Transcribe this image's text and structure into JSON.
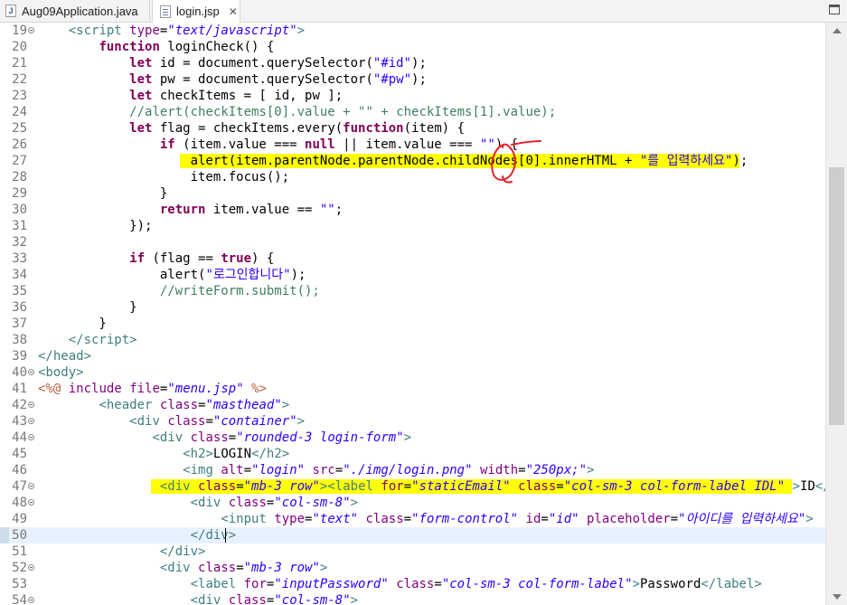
{
  "tabs": [
    {
      "label": "Aug09Application.java",
      "icon": "java-file-icon",
      "active": false
    },
    {
      "label": "login.jsp",
      "icon": "jsp-file-icon",
      "active": true,
      "close": "✕"
    }
  ],
  "editor": {
    "first_line": 19,
    "current_line": 50,
    "fold_lines": [
      19,
      40,
      42,
      43,
      44,
      47,
      48,
      52,
      54
    ],
    "gutter_marks": [
      50
    ],
    "highlight_color": "#ffff00",
    "annotation_color": "#e8202a",
    "lines": [
      [
        [
          "",
          "    "
        ],
        [
          "t",
          "<"
        ],
        [
          "t",
          "script"
        ],
        [
          "",
          " "
        ],
        [
          "an",
          "type"
        ],
        [
          "",
          "="
        ],
        [
          "av",
          "\"text/javascript\""
        ],
        [
          "t",
          ">"
        ]
      ],
      [
        [
          "",
          "        "
        ],
        [
          "k",
          "function"
        ],
        [
          "",
          " loginCheck() {"
        ]
      ],
      [
        [
          "",
          "            "
        ],
        [
          "k",
          "let"
        ],
        [
          "",
          " id = document.querySelector("
        ],
        [
          "s",
          "\"#id\""
        ],
        [
          "",
          ");"
        ]
      ],
      [
        [
          "",
          "            "
        ],
        [
          "k",
          "let"
        ],
        [
          "",
          " pw = document.querySelector("
        ],
        [
          "s",
          "\"#pw\""
        ],
        [
          "",
          ");"
        ]
      ],
      [
        [
          "",
          "            "
        ],
        [
          "k",
          "let"
        ],
        [
          "",
          " checkItems = [ id, pw ];"
        ]
      ],
      [
        [
          "",
          "            "
        ],
        [
          "c",
          "//alert(checkItems[0].value + \"\" + checkItems[1].value);"
        ]
      ],
      [
        [
          "",
          "            "
        ],
        [
          "k",
          "let"
        ],
        [
          "",
          " flag = checkItems.every("
        ],
        [
          "k",
          "function"
        ],
        [
          "",
          "(item) {"
        ]
      ],
      [
        [
          "",
          "                "
        ],
        [
          "k",
          "if"
        ],
        [
          "",
          " (item.value === "
        ],
        [
          "k",
          "null"
        ],
        [
          "",
          " || item.value === "
        ],
        [
          "s",
          "\"\""
        ],
        [
          "",
          ") {"
        ]
      ],
      [
        [
          "",
          "                    alert(item.parentNode.parentNode.childNodes[0].innerHTML + "
        ],
        [
          "s",
          "\"를 입력하세요\""
        ],
        [
          "",
          ");"
        ]
      ],
      [
        [
          "",
          "                    item.focus();"
        ]
      ],
      [
        [
          "",
          "                }"
        ]
      ],
      [
        [
          "",
          "                "
        ],
        [
          "k",
          "return"
        ],
        [
          "",
          " item.value == "
        ],
        [
          "s",
          "\"\""
        ],
        [
          "",
          ";"
        ]
      ],
      [
        [
          "",
          "            });"
        ]
      ],
      [
        [
          "",
          ""
        ]
      ],
      [
        [
          "",
          "            "
        ],
        [
          "k",
          "if"
        ],
        [
          "",
          " (flag == "
        ],
        [
          "k",
          "true"
        ],
        [
          "",
          ") {"
        ]
      ],
      [
        [
          "",
          "                alert("
        ],
        [
          "s",
          "\"로그인합니다\""
        ],
        [
          "",
          ");"
        ]
      ],
      [
        [
          "",
          "                "
        ],
        [
          "c",
          "//writeForm.submit();"
        ]
      ],
      [
        [
          "",
          "            }"
        ]
      ],
      [
        [
          "",
          "        }"
        ]
      ],
      [
        [
          "",
          "    "
        ],
        [
          "t",
          "</"
        ],
        [
          "t",
          "script"
        ],
        [
          "t",
          ">"
        ]
      ],
      [
        [
          "t",
          "</"
        ],
        [
          "t",
          "head"
        ],
        [
          "t",
          ">"
        ]
      ],
      [
        [
          "t",
          "<"
        ],
        [
          "t",
          "body"
        ],
        [
          "t",
          ">"
        ]
      ],
      [
        [
          "d",
          "<%@"
        ],
        [
          "",
          " "
        ],
        [
          "an",
          "include"
        ],
        [
          "",
          " "
        ],
        [
          "an",
          "file"
        ],
        [
          "",
          "="
        ],
        [
          "av",
          "\"menu.jsp\""
        ],
        [
          "",
          " "
        ],
        [
          "d",
          "%>"
        ]
      ],
      [
        [
          "",
          "        "
        ],
        [
          "t",
          "<"
        ],
        [
          "t",
          "header"
        ],
        [
          "",
          " "
        ],
        [
          "an",
          "class"
        ],
        [
          "",
          "="
        ],
        [
          "av",
          "\"masthead\""
        ],
        [
          "t",
          ">"
        ]
      ],
      [
        [
          "",
          "            "
        ],
        [
          "t",
          "<"
        ],
        [
          "t",
          "div"
        ],
        [
          "",
          " "
        ],
        [
          "an",
          "class"
        ],
        [
          "",
          "="
        ],
        [
          "av",
          "\"container\""
        ],
        [
          "t",
          ">"
        ]
      ],
      [
        [
          "",
          "               "
        ],
        [
          "t",
          "<"
        ],
        [
          "t",
          "div"
        ],
        [
          "",
          " "
        ],
        [
          "an",
          "class"
        ],
        [
          "",
          "="
        ],
        [
          "av",
          "\"rounded-3 login-form\""
        ],
        [
          "t",
          ">"
        ]
      ],
      [
        [
          "",
          "                   "
        ],
        [
          "t",
          "<"
        ],
        [
          "t",
          "h2"
        ],
        [
          "t",
          ">"
        ],
        [
          "",
          "LOGIN"
        ],
        [
          "t",
          "</"
        ],
        [
          "t",
          "h2"
        ],
        [
          "t",
          ">"
        ]
      ],
      [
        [
          "",
          "                   "
        ],
        [
          "t",
          "<"
        ],
        [
          "t",
          "img"
        ],
        [
          "",
          " "
        ],
        [
          "an",
          "alt"
        ],
        [
          "",
          "="
        ],
        [
          "av",
          "\"login\""
        ],
        [
          "",
          " "
        ],
        [
          "an",
          "src"
        ],
        [
          "",
          "="
        ],
        [
          "av",
          "\"./img/login.png\""
        ],
        [
          "",
          " "
        ],
        [
          "an",
          "width"
        ],
        [
          "",
          "="
        ],
        [
          "av",
          "\"250px;\""
        ],
        [
          "t",
          ">"
        ]
      ],
      [
        [
          "",
          "                "
        ],
        [
          "t",
          "<"
        ],
        [
          "t",
          "div"
        ],
        [
          "",
          " "
        ],
        [
          "an",
          "class"
        ],
        [
          "",
          "="
        ],
        [
          "av",
          "\"mb-3 row\""
        ],
        [
          "t",
          ">"
        ],
        [
          "t",
          "<"
        ],
        [
          "t",
          "label"
        ],
        [
          "",
          " "
        ],
        [
          "an",
          "for"
        ],
        [
          "",
          "="
        ],
        [
          "av",
          "\"staticEmail\""
        ],
        [
          "",
          " "
        ],
        [
          "an",
          "class"
        ],
        [
          "",
          "="
        ],
        [
          "av",
          "\"col-sm-3 col-form-label IDL\""
        ],
        [
          "",
          " "
        ],
        [
          "t",
          ">"
        ],
        [
          "",
          "ID"
        ],
        [
          "t",
          "</"
        ],
        [
          "t",
          "label"
        ]
      ],
      [
        [
          "",
          "                    "
        ],
        [
          "t",
          "<"
        ],
        [
          "t",
          "div"
        ],
        [
          "",
          " "
        ],
        [
          "an",
          "class"
        ],
        [
          "",
          "="
        ],
        [
          "av",
          "\"col-sm-8\""
        ],
        [
          "t",
          ">"
        ]
      ],
      [
        [
          "",
          "                        "
        ],
        [
          "t",
          "<"
        ],
        [
          "t",
          "input"
        ],
        [
          "",
          " "
        ],
        [
          "an",
          "type"
        ],
        [
          "",
          "="
        ],
        [
          "av",
          "\"text\""
        ],
        [
          "",
          " "
        ],
        [
          "an",
          "class"
        ],
        [
          "",
          "="
        ],
        [
          "av",
          "\"form-control\""
        ],
        [
          "",
          " "
        ],
        [
          "an",
          "id"
        ],
        [
          "",
          "="
        ],
        [
          "av",
          "\"id\""
        ],
        [
          "",
          " "
        ],
        [
          "an",
          "placeholder"
        ],
        [
          "",
          "="
        ],
        [
          "av",
          "\"아이디를 입력하세요\""
        ],
        [
          "t",
          ">"
        ]
      ],
      [
        [
          "",
          "                    "
        ],
        [
          "t",
          "</"
        ],
        [
          "t",
          "div"
        ],
        [
          "t",
          ">"
        ]
      ],
      [
        [
          "",
          "                "
        ],
        [
          "t",
          "</"
        ],
        [
          "t",
          "div"
        ],
        [
          "t",
          ">"
        ]
      ],
      [
        [
          "",
          "                "
        ],
        [
          "t",
          "<"
        ],
        [
          "t",
          "div"
        ],
        [
          "",
          " "
        ],
        [
          "an",
          "class"
        ],
        [
          "",
          "="
        ],
        [
          "av",
          "\"mb-3 row\""
        ],
        [
          "t",
          ">"
        ]
      ],
      [
        [
          "",
          "                    "
        ],
        [
          "t",
          "<"
        ],
        [
          "t",
          "label"
        ],
        [
          "",
          " "
        ],
        [
          "an",
          "for"
        ],
        [
          "",
          "="
        ],
        [
          "av",
          "\"inputPassword\""
        ],
        [
          "",
          " "
        ],
        [
          "an",
          "class"
        ],
        [
          "",
          "="
        ],
        [
          "av",
          "\"col-sm-3 col-form-label\""
        ],
        [
          "t",
          ">"
        ],
        [
          "",
          "Password"
        ],
        [
          "t",
          "</"
        ],
        [
          "t",
          "label"
        ],
        [
          "t",
          ">"
        ]
      ],
      [
        [
          "",
          "                    "
        ],
        [
          "t",
          "<"
        ],
        [
          "t",
          "div"
        ],
        [
          "",
          " "
        ],
        [
          "an",
          "class"
        ],
        [
          "",
          "="
        ],
        [
          "av",
          "\"col-sm-8\""
        ],
        [
          "t",
          ">"
        ]
      ]
    ]
  }
}
